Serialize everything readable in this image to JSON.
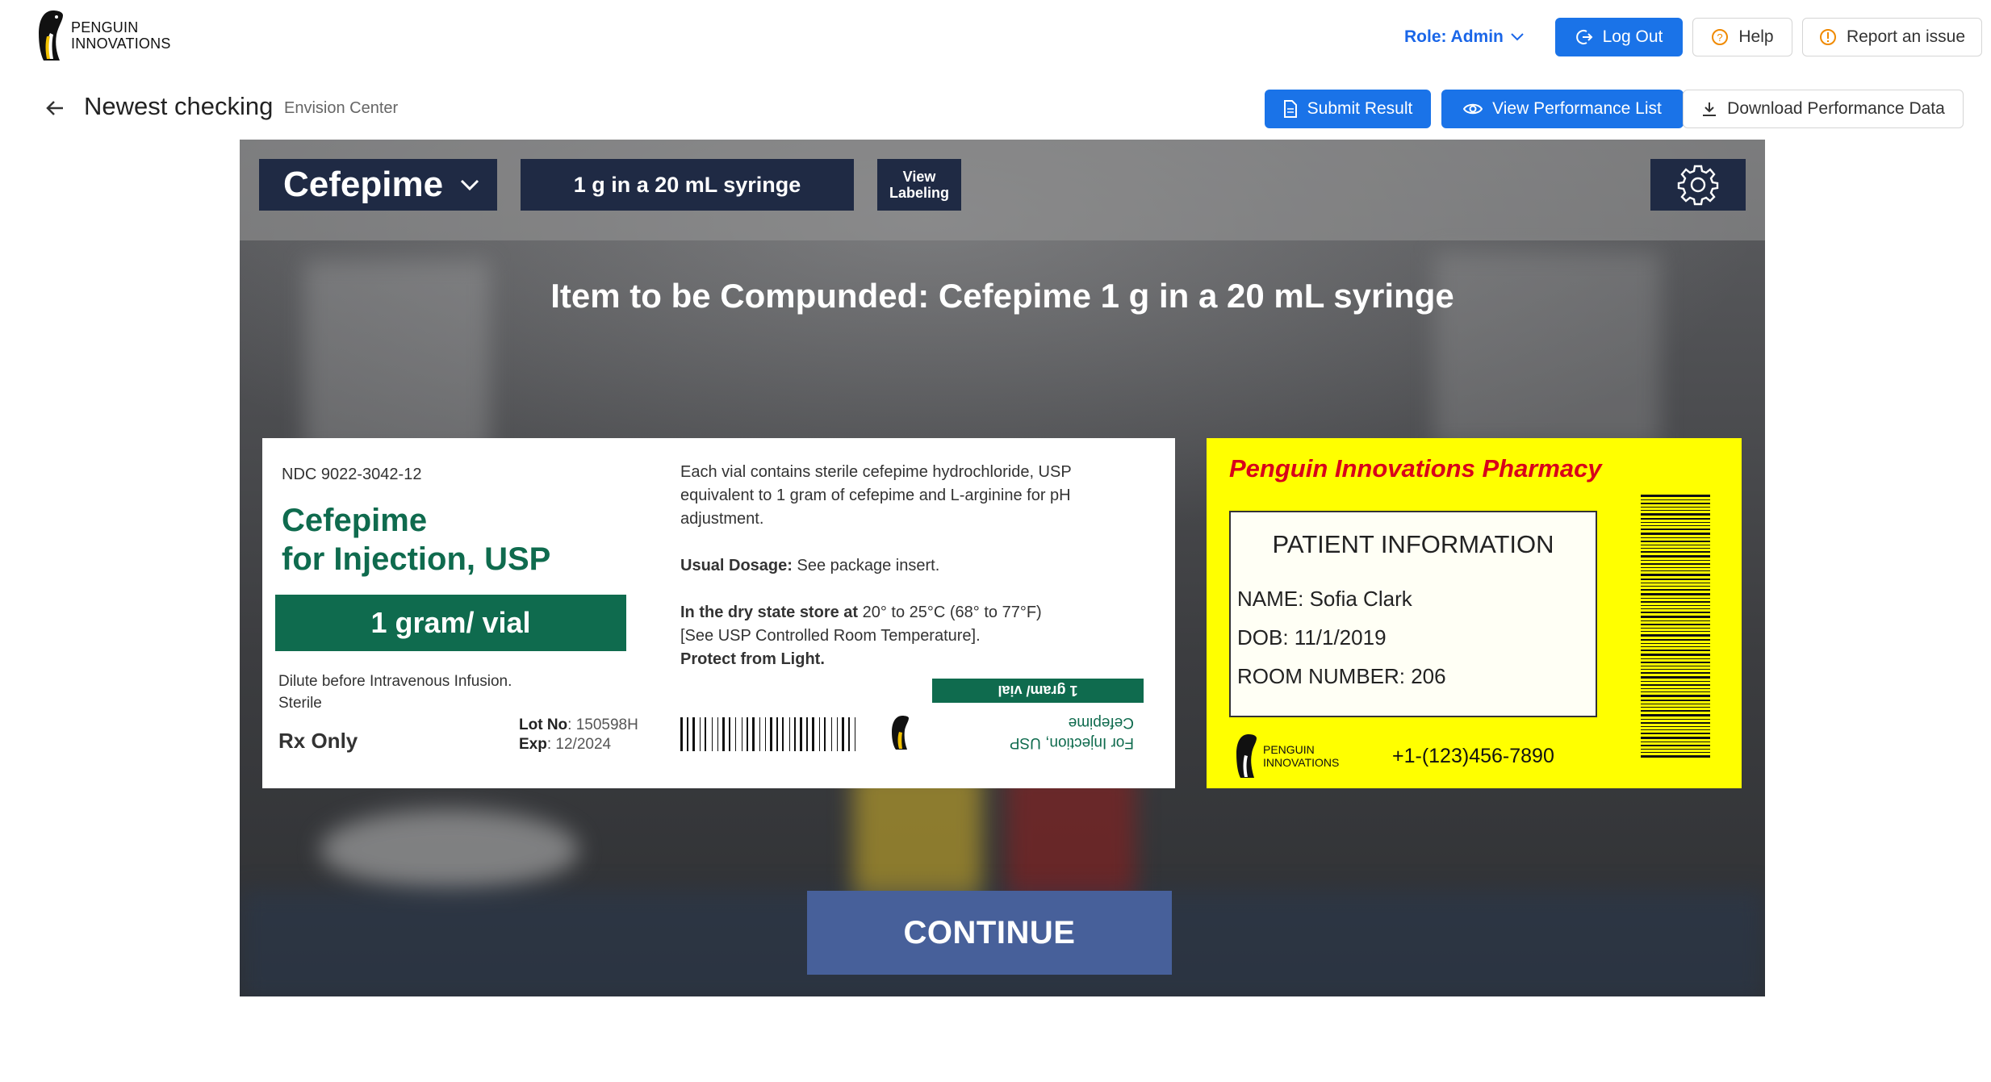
{
  "brand": {
    "line1": "PENGUIN",
    "line2": "INNOVATIONS"
  },
  "header": {
    "role_label": "Role: Admin",
    "logout_label": "Log Out",
    "help_label": "Help",
    "report_label": "Report an issue"
  },
  "subheader": {
    "title": "Newest checking",
    "subtitle": "Envision Center",
    "submit_label": "Submit Result",
    "view_performance_label": "View Performance List",
    "download_label": "Download Performance Data"
  },
  "viewer": {
    "drug_select_value": "Cefepime",
    "dose_value": "1 g in a 20 mL syringe",
    "view_labeling_label": "View Labeling",
    "compound_text": "Item to be Compunded: Cefepime 1 g in a 20 mL syringe",
    "continue_label": "CONTINUE"
  },
  "vial_label": {
    "ndc": "NDC 9022-3042-12",
    "name_line1": "Cefepime",
    "name_line2": "for Injection, USP",
    "strength": "1 gram/ vial",
    "dilute_line1": "Dilute before Intravenous Infusion.",
    "dilute_line2": "Sterile",
    "rx": "Rx Only",
    "lot_label": "Lot No",
    "lot_value": ": 150598H",
    "exp_label": "Exp",
    "exp_value": ": 12/2024",
    "desc_para1": "Each vial contains sterile cefepime hydrochloride, USP equivalent to 1 gram of cefepime and L-arginine for pH adjustment.",
    "usual_label": "Usual Dosage:",
    "usual_value": " See package insert.",
    "storage_bold": "In the dry state store at",
    "storage_rest": " 20° to 25°C (68° to 77°F)",
    "storage_line2": "[See USP Controlled Room Temperature].",
    "protect": "Protect from Light.",
    "flip_strength": "1 gram/ vial",
    "flip_line1": "For Injection, USP",
    "flip_line2": "Cefepime"
  },
  "pharmacy_label": {
    "title": "Penguin Innovations Pharmacy",
    "box_title": "PATIENT INFORMATION",
    "name": "NAME: Sofia Clark",
    "dob": "DOB: 11/1/2019",
    "room": "ROOM NUMBER: 206",
    "logo_line1": "PENGUIN",
    "logo_line2": "INNOVATIONS",
    "phone": "+1-(123)456-7890"
  },
  "colors": {
    "primary": "#1a73e8",
    "role_text": "#1a66e8",
    "control_bg": "#1f2a44",
    "vial_green": "#0f6b4e",
    "pharmacy_yellow": "#ffff00",
    "pharmacy_title": "#d8001a",
    "continue_bg": "#47609a"
  },
  "icons": {
    "logout": "logout-icon",
    "help": "question-circle-icon",
    "report": "info-circle-icon",
    "submit": "file-icon",
    "view": "eye-icon",
    "download": "download-icon",
    "back": "arrow-left-icon",
    "settings": "gear-icon"
  }
}
